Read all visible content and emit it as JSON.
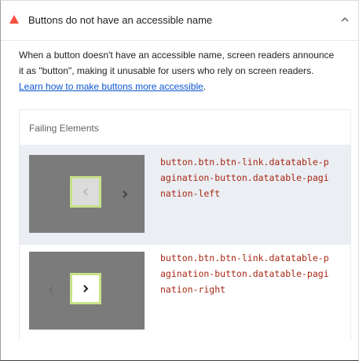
{
  "audit": {
    "title": "Buttons do not have an accessible name",
    "status_icon": "fail-triangle-icon",
    "status_color": "#ff4e42",
    "expanded": true,
    "description_text": "When a button doesn't have an accessible name, screen readers announce it as \"button\", making it unusable for users who rely on screen readers. ",
    "description_link": "Learn how to make buttons more accessible",
    "description_end": "."
  },
  "table": {
    "header": "Failing Elements",
    "rows": [
      {
        "selector": "button.btn.btn-link.datatable-pagination-button.datatable-pagination-left",
        "thumbnail_icon": "chevron-left-icon"
      },
      {
        "selector": "button.btn.btn-link.datatable-pagination-button.datatable-pagination-right",
        "thumbnail_icon": "chevron-right-icon"
      }
    ]
  },
  "colors": {
    "link": "#0b57d0",
    "selector": "#a52714",
    "highlight_border": "#c7e28a",
    "selected_row": "#ebeef2"
  }
}
